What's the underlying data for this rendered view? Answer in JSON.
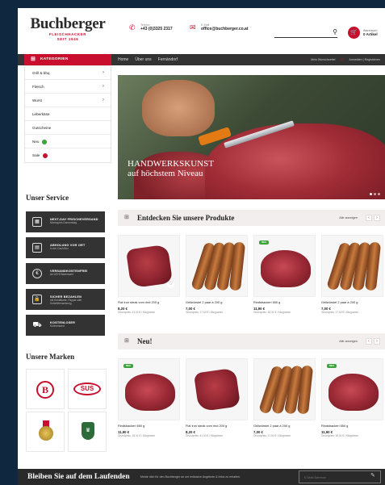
{
  "logo": {
    "name": "Buchberger",
    "sub1": "FLEISCHHACKER",
    "sub2": "SEIT 1946"
  },
  "contact": {
    "phone_label": "Telefon",
    "phone": "+43 (0)3325 2317",
    "email_label": "E-Mail",
    "email": "office@buchberger.co.at"
  },
  "search": {
    "placeholder": ""
  },
  "cart": {
    "label": "Warenkorb",
    "count": "0 Artikel"
  },
  "nav": {
    "categories": "KATEGORIEN",
    "links": [
      "Home",
      "Über uns",
      "Fernändorf"
    ],
    "wishlist": "Mein Wunschzettel",
    "account": "Anmelden | Registrieren"
  },
  "categories": [
    "Grill & bbq",
    "Fleisch",
    "Wurst",
    "Leberkäse",
    "Gutscheine",
    "Neu",
    "Sale"
  ],
  "hero": {
    "line1": "HANDWERKSKUNST",
    "line2": "auf höchstem Niveau"
  },
  "service": {
    "title": "Unser Service",
    "items": [
      {
        "title": "NEXT-DAY FRISCHEVERSAND",
        "sub": "Montag bis Donnerstag"
      },
      {
        "title": "ABHOLUNG VOR ORT",
        "sub": "In der Cash Box"
      },
      {
        "title": "VERSANDKOSTENFREI",
        "sub": "ab 100 € Warenwert"
      },
      {
        "title": "SICHER BEZAHLEN",
        "sub": "mit Kreditkarte, Paypal oder Sofortüberweisung"
      },
      {
        "title": "KOSTENLOSER",
        "sub": "Kühlversand"
      }
    ]
  },
  "brands": {
    "title": "Unsere Marken",
    "b_letter": "B",
    "sus": "SUS"
  },
  "sections": {
    "featured": {
      "title": "Entdecken Sie unsere Produkte",
      "all": "Alle anzeigen"
    },
    "new": {
      "title": "Neu!",
      "all": "Alle anzeigen"
    }
  },
  "badge_new": "NEU",
  "products_featured": [
    {
      "name": "Flat iron steak vom rind 200 g",
      "price": "8,20 €",
      "unit": "Grundpreis: 41,00 € / Kilogramm"
    },
    {
      "name": "Grillwürstel 2 paar à 200 g",
      "price": "7,00 €",
      "unit": "Grundpreis: 17,50 € / Kilogramm"
    },
    {
      "name": "Rindsbackerl 650 g",
      "price": "11,90 €",
      "unit": "Grundpreis: 18,31 € / Kilogramm"
    },
    {
      "name": "Grillwürstel 2 paar à 200 g",
      "price": "7,00 €",
      "unit": "Grundpreis: 17,50 € / Kilogramm"
    }
  ],
  "products_new": [
    {
      "name": "Rindsbackerl 650 g",
      "price": "11,90 €",
      "unit": "Grundpreis: 18,31 € / Kilogramm"
    },
    {
      "name": "Flat iron steak vom rind 200 g",
      "price": "8,20 €",
      "unit": "Grundpreis: 41,00 € / Kilogramm"
    },
    {
      "name": "Grillwürstel 2 paar à 200 g",
      "price": "7,00 €",
      "unit": "Grundpreis: 17,50 € / Kilogramm"
    },
    {
      "name": "Rindsbackerl 650 g",
      "price": "11,90 €",
      "unit": "Grundpreis: 18,31 € / Kilogramm"
    }
  ],
  "newsletter": {
    "title": "Bleiben Sie auf dem Laufenden",
    "desc": "Melde dich für den Buchberger an um exklusive Angebote & Infos zu erhalten.",
    "placeholder": "E-Mail Adresse"
  },
  "colors": {
    "accent": "#c8102e",
    "dark": "#333333",
    "new_badge": "#3aa33a",
    "background": "#0f2840"
  }
}
